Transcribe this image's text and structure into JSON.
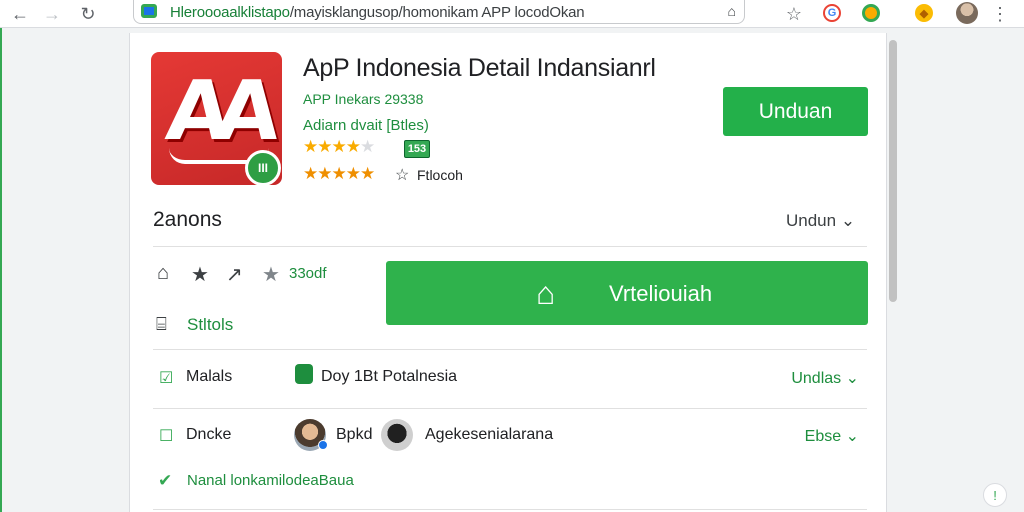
{
  "browser": {
    "url_host": "Hleroooaalklistapo",
    "url_path": "/mayisklangusop/homonikam APP locodOkan",
    "back_icon": "arrow-left-icon",
    "forward_icon": "arrow-right-icon",
    "reload_icon": "reload-icon",
    "menu_icon": "kebab-menu-icon"
  },
  "app": {
    "title": "ApP Indonesia Detail Indansianrl",
    "developer": "APP Inekars 29338",
    "category": "Adiarn dvait [Btles)",
    "age_badge": "153",
    "reviews_label": "Ftlocoh",
    "install_button": "Unduan",
    "icon_letters": "AA",
    "icon_badge": "III"
  },
  "ratings": {
    "stars_top": "★★★★",
    "stars_top_dim": "★",
    "stars_bottom": "★★★★★"
  },
  "section": {
    "heading": "2anons",
    "link": "Undun ⌄"
  },
  "actions": {
    "rating_text": "33odf",
    "stats_label": "Stltols",
    "big_button_label": "Vrteliouiah"
  },
  "rows": [
    {
      "label": "Malals",
      "value": "Doy 1Bt Potalnesia",
      "right": "Undlas ⌄"
    },
    {
      "label": "Dncke",
      "value": "Bpkd",
      "value2": "Agekesenialarana",
      "right": "Ebse ⌄"
    }
  ],
  "footer": {
    "text": "Nanal lonkamilodeaBaua"
  },
  "colors": {
    "accent_green": "#23b04a",
    "text_green": "#1e8e3e",
    "icon_red": "#e53935",
    "star_yellow": "#f9ab00"
  }
}
